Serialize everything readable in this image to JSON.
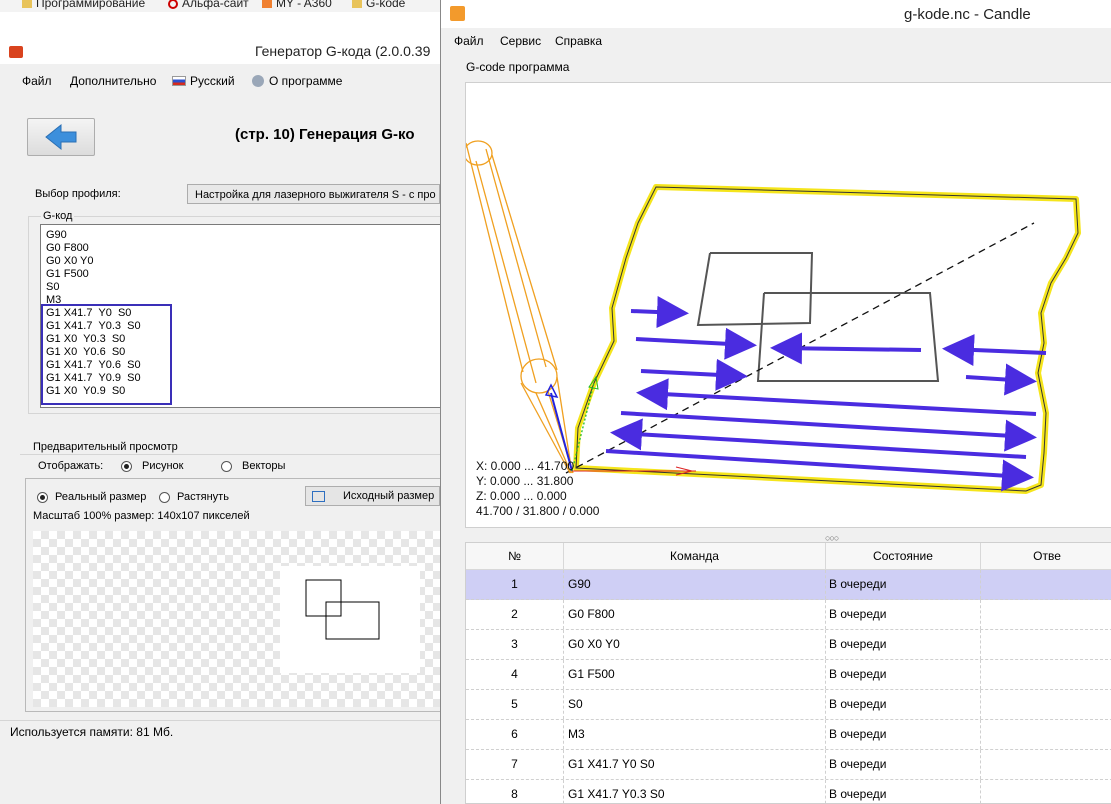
{
  "bookmarks": [
    {
      "label": "Программирование",
      "icon": "folder-icon"
    },
    {
      "label": "Альфа-сайт",
      "icon": "swirl-icon"
    },
    {
      "label": "MY - A360",
      "icon": "a360-icon"
    },
    {
      "label": "G-kode",
      "icon": "folder-icon"
    }
  ],
  "generator": {
    "title": "Генератор G-кода (2.0.0.39",
    "menu": [
      "Файл",
      "Дополнительно",
      "Русский",
      "О программе"
    ],
    "page_heading": "(стр. 10) Генерация G-ко",
    "profile_label": "Выбор профиля:",
    "profile_value": "Настройка для лазерного выжигателя S - с про",
    "gcode_legend": "G-код",
    "gcode_lines": [
      "G90",
      "G0 F800",
      "G0 X0 Y0",
      "G1 F500",
      "S0",
      "M3",
      "G1 X41.7  Y0  S0",
      "G1 X41.7  Y0.3  S0",
      "G1 X0  Y0.3  S0",
      "G1 X0  Y0.6  S0",
      "G1 X41.7  Y0.6  S0",
      "G1 X41.7  Y0.9  S0",
      "G1 X0  Y0.9  S0"
    ],
    "preview_legend": "Предварительный просмотр",
    "display_label": "Отображать:",
    "display_options": [
      "Рисунок",
      "Векторы"
    ],
    "size_options": [
      "Реальный размер",
      "Растянуть"
    ],
    "orig_size_button": "Исходный размер",
    "scale_text": "Масштаб 100% размер: 140x107 пикселей",
    "status_text": "Используется памяти:  81  Мб."
  },
  "candle": {
    "title": "g-kode.nc - Candle",
    "menu": [
      "Файл",
      "Сервис",
      "Справка"
    ],
    "program_label": "G-code программа",
    "coords": [
      "X: 0.000 ... 41.700",
      "Y: 0.000 ... 31.800",
      "Z: 0.000 ... 0.000",
      "41.700 / 31.800 / 0.000"
    ],
    "columns": [
      "№",
      "Команда",
      "Состояние",
      "Отве"
    ],
    "rows": [
      {
        "n": "1",
        "cmd": "G90",
        "state": "В очереди"
      },
      {
        "n": "2",
        "cmd": "G0 F800",
        "state": "В очереди"
      },
      {
        "n": "3",
        "cmd": "G0 X0 Y0",
        "state": "В очереди"
      },
      {
        "n": "4",
        "cmd": "G1 F500",
        "state": "В очереди"
      },
      {
        "n": "5",
        "cmd": "S0",
        "state": "В очереди"
      },
      {
        "n": "6",
        "cmd": "M3",
        "state": "В очереди"
      },
      {
        "n": "7",
        "cmd": "G1 X41.7  Y0  S0",
        "state": "В очереди"
      },
      {
        "n": "8",
        "cmd": "G1 X41.7  Y0.3  S0",
        "state": "В очереди"
      }
    ]
  },
  "colors": {
    "annotation": "#3a2fb8",
    "highlight_yellow": "#f5e51c",
    "tool_orange": "#f0a020",
    "selected_row": "#cfcff5"
  }
}
